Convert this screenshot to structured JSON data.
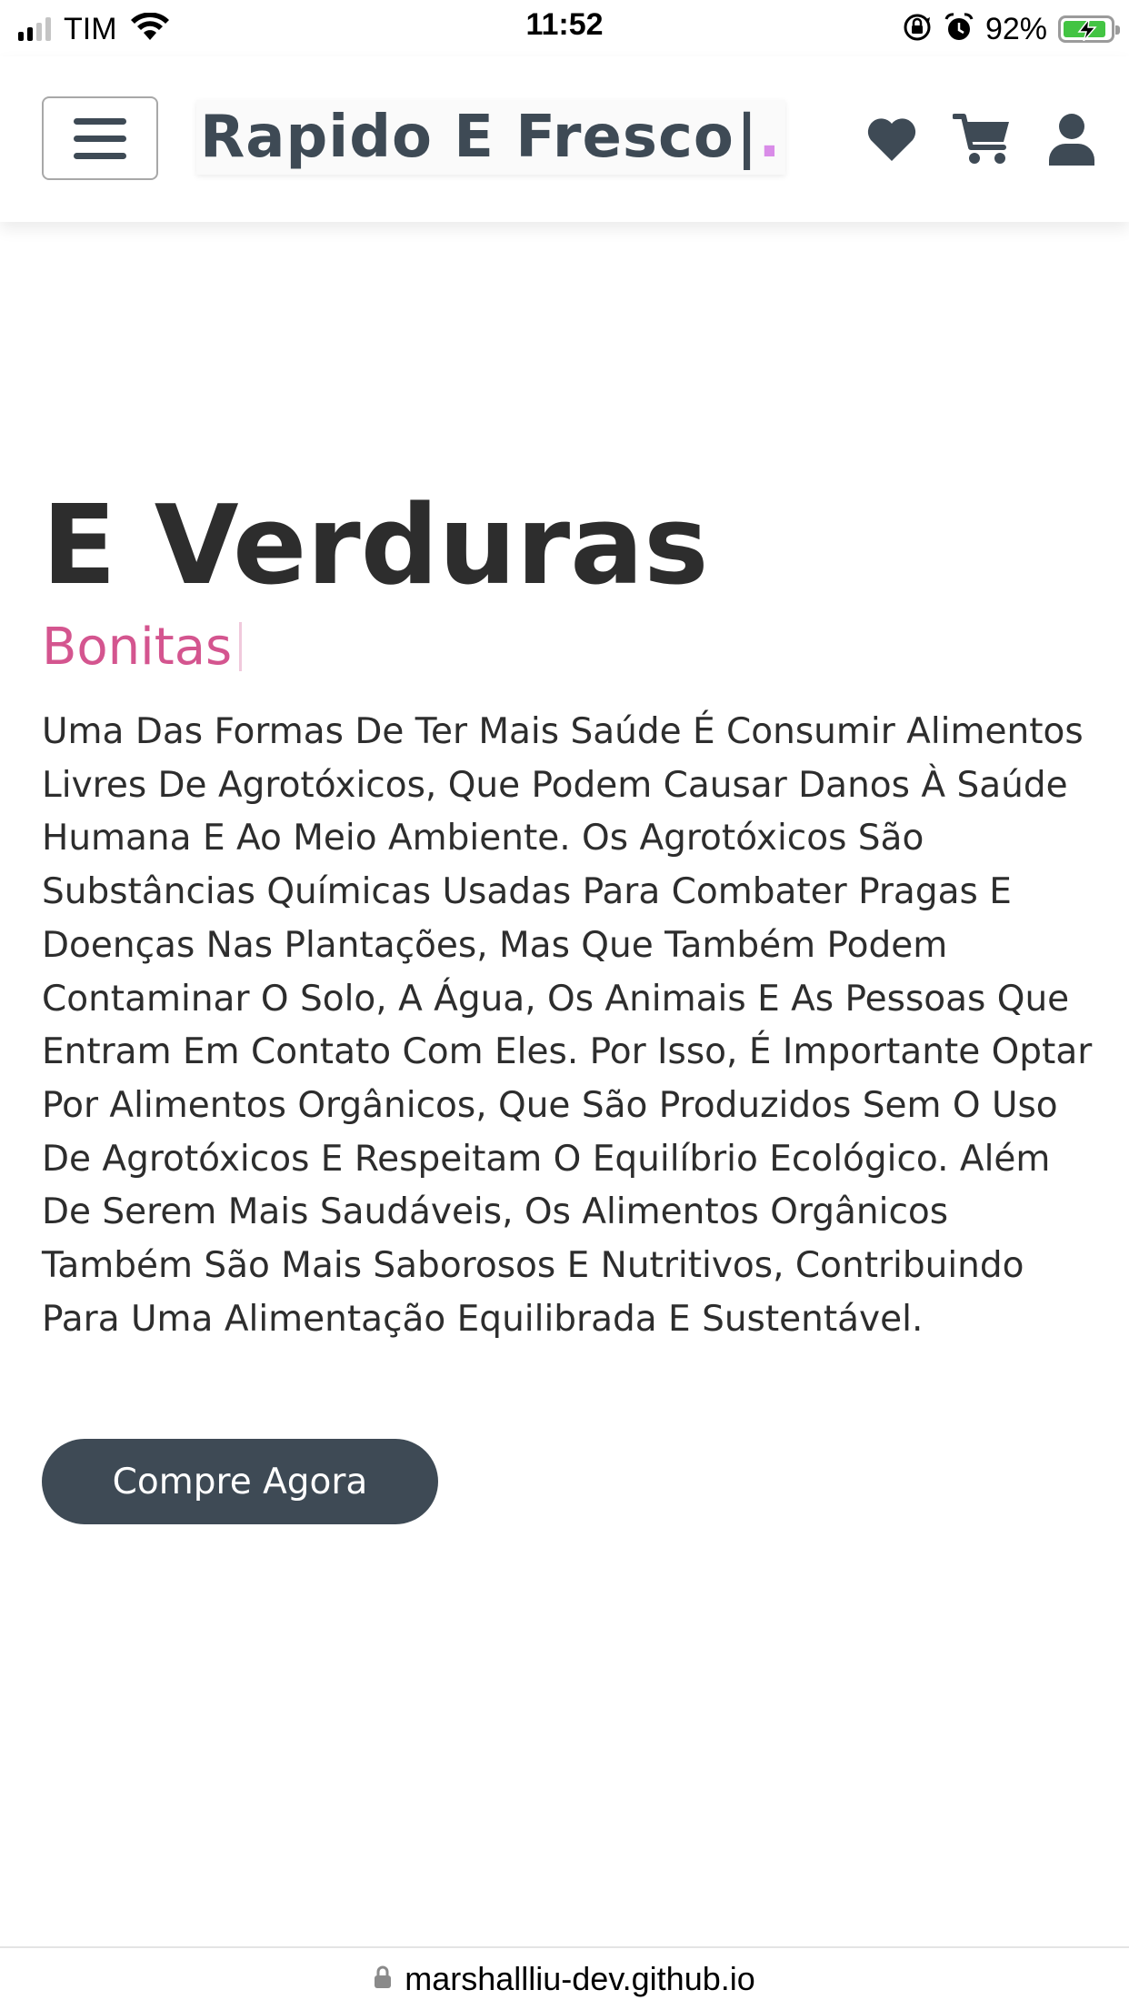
{
  "status_bar": {
    "carrier": "TIM",
    "time": "11:52",
    "battery_percent": "92%",
    "battery_level": 0.92,
    "icons": [
      "signal-icon",
      "wifi-icon",
      "rotation-lock-icon",
      "alarm-icon",
      "battery-charging-icon"
    ]
  },
  "header": {
    "brand": "Rapido E Fresco",
    "brand_cursor": "|",
    "brand_dot": ".",
    "icons": [
      "menu-icon",
      "heart-icon",
      "cart-icon",
      "user-icon"
    ]
  },
  "hero": {
    "title": "E Verduras",
    "subtitle": "Bonitas",
    "paragraph": "Uma Das Formas De Ter Mais Saúde É Consumir Alimentos Livres De Agrotóxicos, Que Podem Causar Danos À Saúde Humana E Ao Meio Ambiente. Os Agrotóxicos São Substâncias Químicas Usadas Para Combater Pragas E Doenças Nas Plantações, Mas Que Também Podem Contaminar O Solo, A Água, Os Animais E As Pessoas Que Entram Em Contato Com Eles. Por Isso, É Importante Optar Por Alimentos Orgânicos, Que São Produzidos Sem O Uso De Agrotóxicos E Respeitam O Equilíbrio Ecológico. Além De Serem Mais Saudáveis, Os Alimentos Orgânicos Também São Mais Saborosos E Nutritivos, Contribuindo Para Uma Alimentação Equilibrada E Sustentável.",
    "button_label": "Compre Agora"
  },
  "url_bar": {
    "url": "marshallliu-dev.github.io",
    "icon": "lock-icon"
  },
  "colors": {
    "primary": "#3e4a55",
    "accent_pink": "#d4558f",
    "dot_lilac": "#d98ce8",
    "text": "#2d2d2d",
    "battery_green": "#43c443"
  }
}
